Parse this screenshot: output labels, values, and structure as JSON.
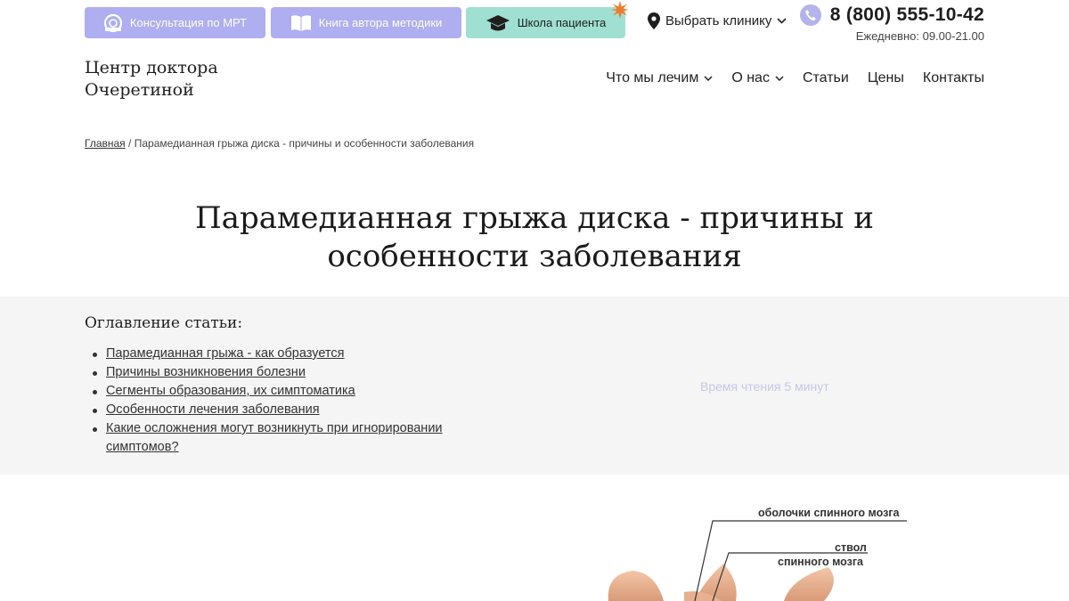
{
  "topbar": {
    "mri_label": "Консультация по МРТ",
    "book_label": "Книга автора методики",
    "school_label": "Школа пациента",
    "clinic_label": "Выбрать клинику",
    "phone": "8 (800) 555-10-42",
    "hours": "Ежедневно: 09.00-21.00"
  },
  "header": {
    "logo_line1": "Центр доктора",
    "logo_line2": "Очеретиной",
    "nav": [
      {
        "label": "Что мы лечим"
      },
      {
        "label": "О нас"
      },
      {
        "label": "Статьи"
      },
      {
        "label": "Цены"
      },
      {
        "label": "Контакты"
      }
    ]
  },
  "breadcrumb": {
    "home": "Главная",
    "separator": "/",
    "current": "Парамедианная грыжа диска - причины и особенности заболевания"
  },
  "article": {
    "title": "Парамедианная грыжа диска - причины и особенности заболевания"
  },
  "toc": {
    "heading": "Оглавление статьи:",
    "items": [
      "Парамедианная грыжа - как образуется",
      "Причины возникновения болезни",
      "Сегменты образования, их симптоматика",
      "Особенности лечения заболевания",
      "Какие осложнения могут возникнуть при игнорировании симптомов?"
    ],
    "read_time": "Время чтения 5 минут"
  },
  "diagram": {
    "labels": [
      "оболочки спинного мозга",
      "ствол",
      "спинного мозга"
    ]
  },
  "colors": {
    "pill_violet": "#aeaef0",
    "pill_mint": "#9fe0d2",
    "star": "#f07a2a",
    "toc_bg": "#f5f5f5"
  }
}
